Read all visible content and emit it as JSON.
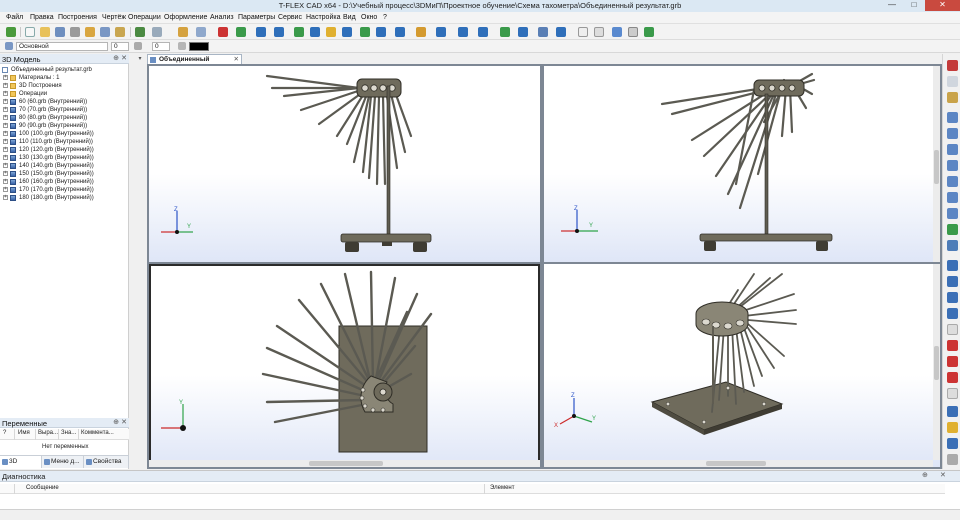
{
  "window": {
    "title": "T-FLEX CAD x64 - D:\\Учебный процесс\\3DМиП\\Проектное обучение\\Схема тахометра\\Объединенный результат.grb",
    "minimize_glyph": "—",
    "maximize_glyph": "□",
    "close_glyph": "✕"
  },
  "menu": [
    "Файл",
    "Правка",
    "Построения",
    "Чертёж",
    "Операции",
    "Оформление",
    "Анализ",
    "Параметры",
    "Сервис",
    "Настройка",
    "Вид",
    "Окно",
    "?"
  ],
  "property_bar": {
    "layer": "Основной",
    "value1": "0",
    "value2": "0",
    "color_hex": "#000000"
  },
  "left_panel": {
    "title": "3D Модель",
    "tree": [
      {
        "label": "Объединенный результат.grb",
        "icon": "document-icon",
        "level": 0,
        "expander": ""
      },
      {
        "label": "Материалы : 1",
        "icon": "folder-icon",
        "level": 1,
        "expander": "+"
      },
      {
        "label": "3D Построения",
        "icon": "folder-icon",
        "level": 1,
        "expander": "+"
      },
      {
        "label": "Операции",
        "icon": "folder-icon",
        "level": 1,
        "expander": "+"
      },
      {
        "label": "60 (60.grb (Внутренний))",
        "icon": "fragment-icon",
        "level": 1,
        "expander": "+"
      },
      {
        "label": "70 (70.grb (Внутренний))",
        "icon": "fragment-icon",
        "level": 1,
        "expander": "+"
      },
      {
        "label": "80 (80.grb (Внутренний))",
        "icon": "fragment-icon",
        "level": 1,
        "expander": "+"
      },
      {
        "label": "90 (90.grb (Внутренний))",
        "icon": "fragment-icon",
        "level": 1,
        "expander": "+"
      },
      {
        "label": "100 (100.grb (Внутренний))",
        "icon": "fragment-icon",
        "level": 1,
        "expander": "+"
      },
      {
        "label": "110 (110.grb (Внутренний))",
        "icon": "fragment-icon",
        "level": 1,
        "expander": "+"
      },
      {
        "label": "120 (120.grb (Внутренний))",
        "icon": "fragment-icon",
        "level": 1,
        "expander": "+"
      },
      {
        "label": "130 (130.grb (Внутренний))",
        "icon": "fragment-icon",
        "level": 1,
        "expander": "+"
      },
      {
        "label": "140 (140.grb (Внутренний))",
        "icon": "fragment-icon",
        "level": 1,
        "expander": "+"
      },
      {
        "label": "150 (150.grb (Внутренний))",
        "icon": "fragment-icon",
        "level": 1,
        "expander": "+"
      },
      {
        "label": "160 (160.grb (Внутренний))",
        "icon": "fragment-icon",
        "level": 1,
        "expander": "+"
      },
      {
        "label": "170 (170.grb (Внутренний))",
        "icon": "fragment-icon",
        "level": 1,
        "expander": "+"
      },
      {
        "label": "180 (180.grb (Внутренний))",
        "icon": "fragment-icon",
        "level": 1,
        "expander": "+"
      }
    ],
    "tabs": [
      "3D Модель",
      "Меню д...",
      "Свойства"
    ]
  },
  "variables_panel": {
    "title": "Переменные",
    "columns": [
      "?",
      "Имя",
      "Выра...",
      "Зна...",
      "Коммента..."
    ],
    "empty_text": "Нет переменных"
  },
  "document_tab": {
    "label": "Объединенный результат.grb"
  },
  "viewports": [
    {
      "name": "front",
      "active": false
    },
    {
      "name": "side",
      "active": false
    },
    {
      "name": "top",
      "active": true
    },
    {
      "name": "isometric",
      "active": false
    }
  ],
  "axes": {
    "z": "Z",
    "y": "Y",
    "x": "X"
  },
  "diagnostics": {
    "title": "Диагностика",
    "columns": [
      "Сообщение",
      "Элемент"
    ]
  },
  "colors": {
    "accent": "#3b6fb6",
    "close": "#c94a3f",
    "model_fill": "#6f6b5c",
    "model_stroke": "#2f2d26"
  }
}
